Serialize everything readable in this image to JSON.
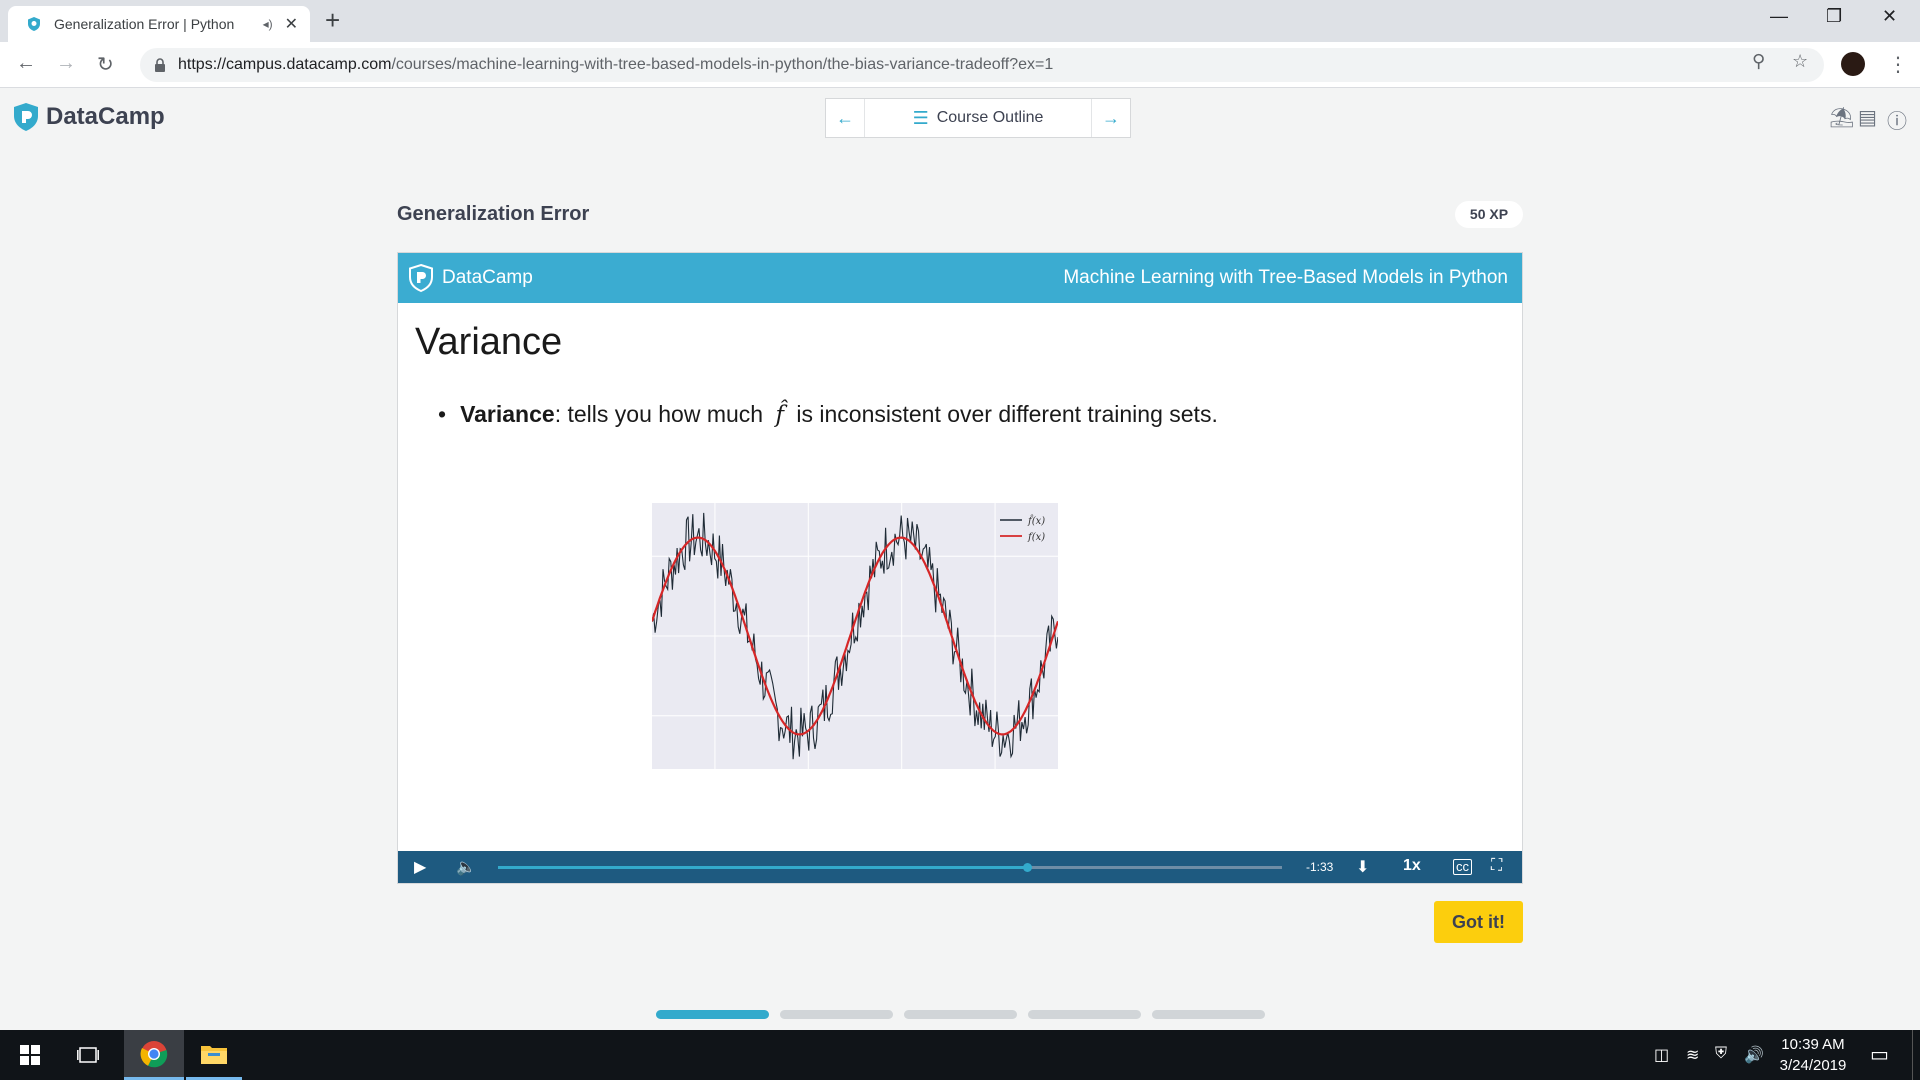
{
  "browser": {
    "tab_title": "Generalization Error | Python",
    "url_host": "https://campus.datacamp.com",
    "url_path": "/courses/machine-learning-with-tree-based-models-in-python/the-bias-variance-tradeoff?ex=1"
  },
  "header": {
    "logo_text": "DataCamp",
    "course_outline_label": "Course Outline"
  },
  "exercise": {
    "title": "Generalization Error",
    "xp": "50 XP",
    "got_it_label": "Got it!"
  },
  "slide": {
    "brand": "DataCamp",
    "course_name": "Machine Learning with Tree-Based Models in Python",
    "heading": "Variance",
    "bullet_term": "Variance",
    "bullet_before": ": tells you how much",
    "bullet_symbol": "f̂",
    "bullet_after": "is inconsistent over different training sets.",
    "plot_legend": [
      "f̂(x)",
      "f(x)"
    ]
  },
  "player": {
    "progress": 0.675,
    "time_remaining": "-1:33",
    "rate": "1x"
  },
  "lesson_steps": {
    "total": 5,
    "active": 0
  },
  "taskbar": {
    "time": "10:39 AM",
    "date": "3/24/2019"
  },
  "colors": {
    "accent": "#33aacc",
    "slide_bar": "#3bacd1",
    "player_bar": "#1e5a80",
    "got_it": "#fcce0d"
  }
}
